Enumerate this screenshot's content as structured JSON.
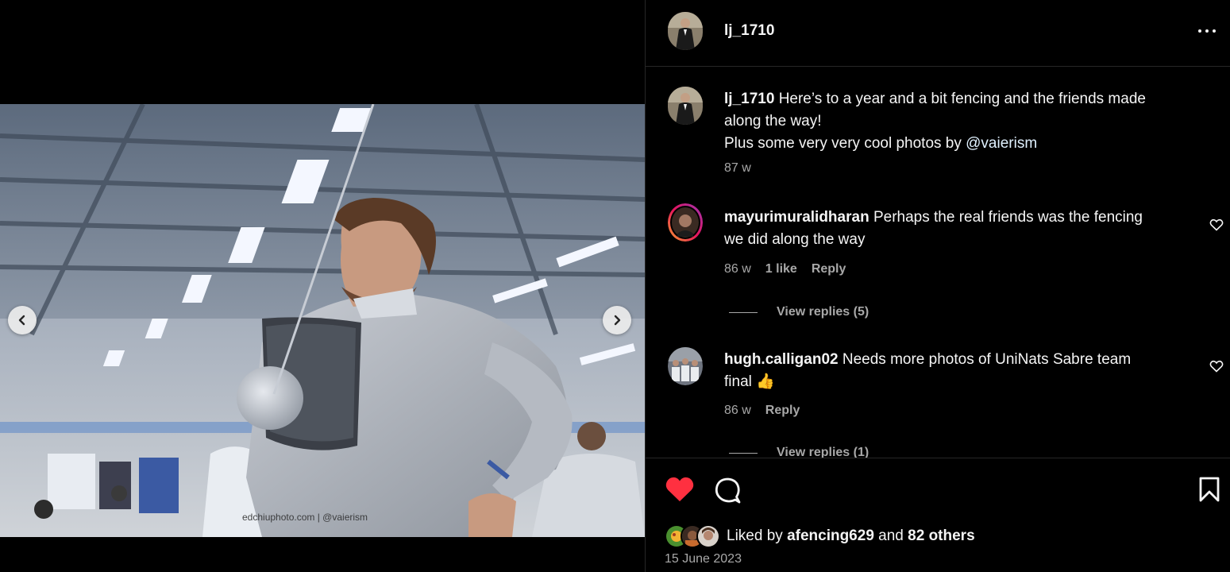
{
  "post": {
    "author": "lj_1710",
    "watermark": "edchiuphoto.com | @vaierism",
    "caption": {
      "username": "lj_1710",
      "line1": "Here’s to a year and a bit fencing and the friends made",
      "line2": "along the way!",
      "line3_prefix": "Plus some very very cool photos by",
      "mention": "@vaierism",
      "age": "87 w"
    }
  },
  "comments": [
    {
      "username": "mayurimuralidharan",
      "text_line1": "Perhaps the real friends was the fencing",
      "text_line2": "we did along the way",
      "age": "86 w",
      "likes": "1 like",
      "reply_label": "Reply",
      "view_replies": "View replies (5)"
    },
    {
      "username": "hugh.calligan02",
      "text_line1": "Needs more photos of UniNats Sabre team",
      "text_line2": "final 👍",
      "age": "86 w",
      "reply_label": "Reply",
      "view_replies": "View replies (1)"
    }
  ],
  "engagement": {
    "liked_prefix": "Liked by",
    "liked_user": "afencing629",
    "liked_and": "and",
    "liked_others": "82 others",
    "date": "15 June 2023"
  },
  "colors": {
    "background": "#000000",
    "like_red": "#ff3040",
    "secondary_text": "#a8a8a8",
    "divider": "#262626"
  },
  "icons": [
    "more-options-icon",
    "heart-filled-icon",
    "comment-icon",
    "bookmark-icon",
    "chevron-left-icon",
    "chevron-right-icon",
    "heart-outline-icon"
  ]
}
